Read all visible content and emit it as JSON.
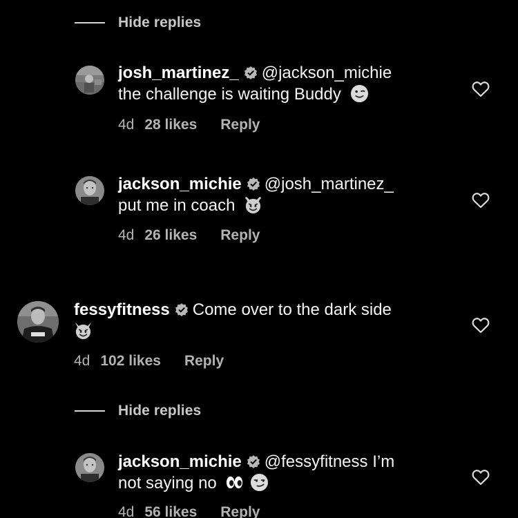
{
  "hide_replies_label": "Hide replies",
  "comments": [
    {
      "username": "josh_martinez_",
      "mention": "@jackson_michie",
      "text_line2": "the challenge is waiting Buddy",
      "emoji": "winking-face",
      "time": "4d",
      "likes": "28 likes",
      "reply": "Reply"
    },
    {
      "username": "jackson_michie",
      "mention": "@josh_martinez_",
      "text_line2": "put me in coach",
      "emoji": "smiling-imp",
      "time": "4d",
      "likes": "26 likes",
      "reply": "Reply"
    },
    {
      "username": "fessyfitness",
      "text": "Come over to the dark side",
      "emoji": "smiling-imp",
      "time": "4d",
      "likes": "102 likes",
      "reply": "Reply"
    },
    {
      "username": "jackson_michie",
      "mention": "@fessyfitness",
      "text_rest": "I’m",
      "text_line2": "not saying no",
      "emoji": [
        "eyes",
        "smirking-face"
      ],
      "time": "4d",
      "likes": "56 likes",
      "reply": "Reply"
    }
  ],
  "colors": {
    "background": "#000000",
    "text": "#f4f4f4",
    "secondary_text": "#b3b3b3",
    "hide_replies": "#c8c8c8"
  }
}
